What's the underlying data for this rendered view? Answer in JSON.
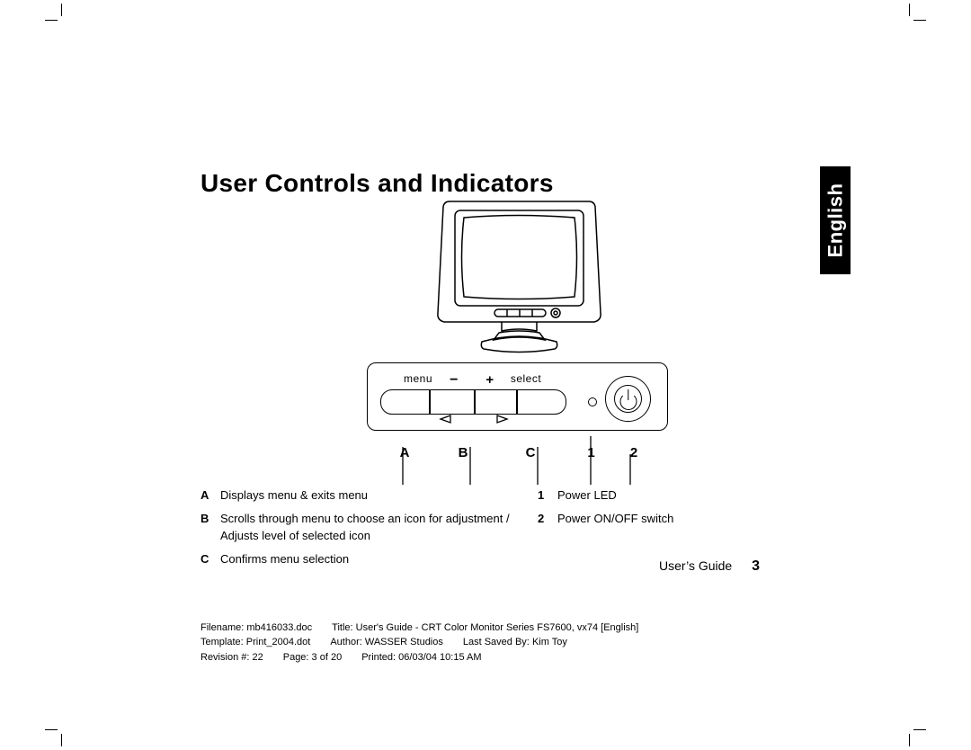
{
  "title": "User Controls and Indicators",
  "language_tab": "English",
  "panel": {
    "menu_label": "menu",
    "minus_label": "−",
    "plus_label": "+",
    "select_label": "select"
  },
  "callouts": {
    "a": "A",
    "b": "B",
    "c": "C",
    "one": "1",
    "two": "2"
  },
  "descriptions": {
    "a": {
      "key": "A",
      "text": "Displays menu & exits menu"
    },
    "b": {
      "key": "B",
      "text": "Scrolls through menu to choose an icon for adjustment / Adjusts level of selected icon"
    },
    "c": {
      "key": "C",
      "text": "Confirms menu selection"
    },
    "one": {
      "key": "1",
      "text": "Power LED"
    },
    "two": {
      "key": "2",
      "text": "Power ON/OFF switch"
    }
  },
  "footer_guide": {
    "label": "User’s Guide",
    "page": "3"
  },
  "meta": {
    "line1": {
      "filename_label": "Filename:",
      "filename": "mb416033.doc",
      "title_label": "Title:",
      "title": "User's Guide - CRT Color Monitor Series FS7600, vx74 [English]"
    },
    "line2": {
      "template_label": "Template:",
      "template": "Print_2004.dot",
      "author_label": "Author:",
      "author": "WASSER Studios",
      "saved_label": "Last Saved By:",
      "saved": "Kim Toy"
    },
    "line3": {
      "rev_label": "Revision #:",
      "rev": "22",
      "page_label": "Page:",
      "page": "3 of 20",
      "printed_label": "Printed:",
      "printed": "06/03/04 10:15 AM"
    }
  }
}
